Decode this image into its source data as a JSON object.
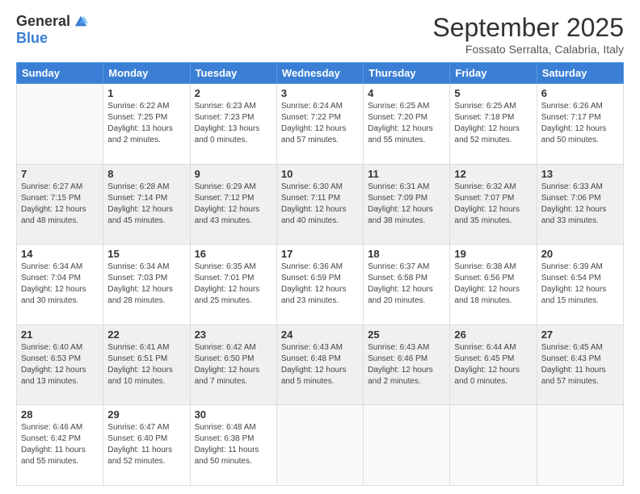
{
  "logo": {
    "general": "General",
    "blue": "Blue"
  },
  "header": {
    "month": "September 2025",
    "location": "Fossato Serralta, Calabria, Italy"
  },
  "weekdays": [
    "Sunday",
    "Monday",
    "Tuesday",
    "Wednesday",
    "Thursday",
    "Friday",
    "Saturday"
  ],
  "weeks": [
    [
      null,
      {
        "day": 1,
        "sunrise": "6:22 AM",
        "sunset": "7:25 PM",
        "daylight": "13 hours and 2 minutes."
      },
      {
        "day": 2,
        "sunrise": "6:23 AM",
        "sunset": "7:23 PM",
        "daylight": "13 hours and 0 minutes."
      },
      {
        "day": 3,
        "sunrise": "6:24 AM",
        "sunset": "7:22 PM",
        "daylight": "12 hours and 57 minutes."
      },
      {
        "day": 4,
        "sunrise": "6:25 AM",
        "sunset": "7:20 PM",
        "daylight": "12 hours and 55 minutes."
      },
      {
        "day": 5,
        "sunrise": "6:25 AM",
        "sunset": "7:18 PM",
        "daylight": "12 hours and 52 minutes."
      },
      {
        "day": 6,
        "sunrise": "6:26 AM",
        "sunset": "7:17 PM",
        "daylight": "12 hours and 50 minutes."
      }
    ],
    [
      {
        "day": 7,
        "sunrise": "6:27 AM",
        "sunset": "7:15 PM",
        "daylight": "12 hours and 48 minutes."
      },
      {
        "day": 8,
        "sunrise": "6:28 AM",
        "sunset": "7:14 PM",
        "daylight": "12 hours and 45 minutes."
      },
      {
        "day": 9,
        "sunrise": "6:29 AM",
        "sunset": "7:12 PM",
        "daylight": "12 hours and 43 minutes."
      },
      {
        "day": 10,
        "sunrise": "6:30 AM",
        "sunset": "7:11 PM",
        "daylight": "12 hours and 40 minutes."
      },
      {
        "day": 11,
        "sunrise": "6:31 AM",
        "sunset": "7:09 PM",
        "daylight": "12 hours and 38 minutes."
      },
      {
        "day": 12,
        "sunrise": "6:32 AM",
        "sunset": "7:07 PM",
        "daylight": "12 hours and 35 minutes."
      },
      {
        "day": 13,
        "sunrise": "6:33 AM",
        "sunset": "7:06 PM",
        "daylight": "12 hours and 33 minutes."
      }
    ],
    [
      {
        "day": 14,
        "sunrise": "6:34 AM",
        "sunset": "7:04 PM",
        "daylight": "12 hours and 30 minutes."
      },
      {
        "day": 15,
        "sunrise": "6:34 AM",
        "sunset": "7:03 PM",
        "daylight": "12 hours and 28 minutes."
      },
      {
        "day": 16,
        "sunrise": "6:35 AM",
        "sunset": "7:01 PM",
        "daylight": "12 hours and 25 minutes."
      },
      {
        "day": 17,
        "sunrise": "6:36 AM",
        "sunset": "6:59 PM",
        "daylight": "12 hours and 23 minutes."
      },
      {
        "day": 18,
        "sunrise": "6:37 AM",
        "sunset": "6:58 PM",
        "daylight": "12 hours and 20 minutes."
      },
      {
        "day": 19,
        "sunrise": "6:38 AM",
        "sunset": "6:56 PM",
        "daylight": "12 hours and 18 minutes."
      },
      {
        "day": 20,
        "sunrise": "6:39 AM",
        "sunset": "6:54 PM",
        "daylight": "12 hours and 15 minutes."
      }
    ],
    [
      {
        "day": 21,
        "sunrise": "6:40 AM",
        "sunset": "6:53 PM",
        "daylight": "12 hours and 13 minutes."
      },
      {
        "day": 22,
        "sunrise": "6:41 AM",
        "sunset": "6:51 PM",
        "daylight": "12 hours and 10 minutes."
      },
      {
        "day": 23,
        "sunrise": "6:42 AM",
        "sunset": "6:50 PM",
        "daylight": "12 hours and 7 minutes."
      },
      {
        "day": 24,
        "sunrise": "6:43 AM",
        "sunset": "6:48 PM",
        "daylight": "12 hours and 5 minutes."
      },
      {
        "day": 25,
        "sunrise": "6:43 AM",
        "sunset": "6:46 PM",
        "daylight": "12 hours and 2 minutes."
      },
      {
        "day": 26,
        "sunrise": "6:44 AM",
        "sunset": "6:45 PM",
        "daylight": "12 hours and 0 minutes."
      },
      {
        "day": 27,
        "sunrise": "6:45 AM",
        "sunset": "6:43 PM",
        "daylight": "11 hours and 57 minutes."
      }
    ],
    [
      {
        "day": 28,
        "sunrise": "6:46 AM",
        "sunset": "6:42 PM",
        "daylight": "11 hours and 55 minutes."
      },
      {
        "day": 29,
        "sunrise": "6:47 AM",
        "sunset": "6:40 PM",
        "daylight": "11 hours and 52 minutes."
      },
      {
        "day": 30,
        "sunrise": "6:48 AM",
        "sunset": "6:38 PM",
        "daylight": "11 hours and 50 minutes."
      },
      null,
      null,
      null,
      null
    ]
  ]
}
